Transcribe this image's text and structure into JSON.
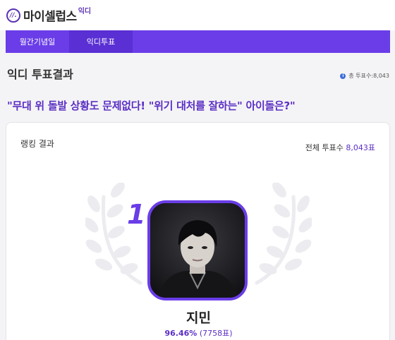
{
  "header": {
    "logo_badge": "//.",
    "logo_text": "마이셀럽스",
    "logo_sup": "익디"
  },
  "nav": {
    "tabs": [
      {
        "label": "월간기념일",
        "active": false
      },
      {
        "label": "익디투표",
        "active": true
      }
    ],
    "accent": "#6a3de8"
  },
  "section": {
    "title": "익디 투표결과",
    "total_label": "총 투표수:8,043"
  },
  "question": "\"무대 위 돌발 상황도 문제없다! \"위기 대처를 잘하는\" 아이돌은?\"",
  "ranking": {
    "label": "랭킹 결과",
    "total_votes_label": "전체 투표수",
    "total_votes_value": "8,043표",
    "winner": {
      "rank": "1",
      "name": "지민",
      "percent": "96.46%",
      "votes": "(7758표)"
    }
  },
  "icons": [
    "logo-badge-icon",
    "info-icon",
    "laurel-left-icon",
    "laurel-right-icon"
  ]
}
